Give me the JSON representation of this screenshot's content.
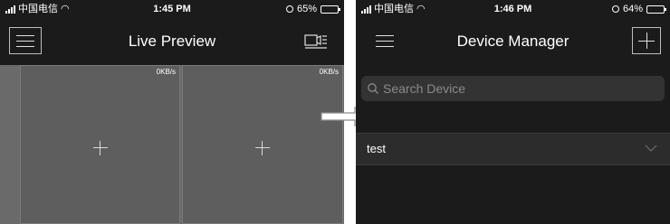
{
  "left_phone": {
    "status": {
      "carrier": "中国电信",
      "time": "1:45 PM",
      "battery": "65%",
      "battery_level": 0.65
    },
    "nav": {
      "title": "Live Preview",
      "menu_icon": "hamburger-menu-icon",
      "layout_icon": "layout-switch-icon"
    },
    "cells": [
      {
        "bitrate": "0KB/s",
        "icon": "plus-icon"
      },
      {
        "bitrate": "0KB/s",
        "icon": "plus-icon"
      }
    ]
  },
  "right_phone": {
    "status": {
      "carrier": "中国电信",
      "time": "1:46 PM",
      "battery": "64%",
      "battery_level": 0.64
    },
    "nav": {
      "title": "Device Manager",
      "menu_icon": "hamburger-menu-icon",
      "add_icon": "plus-icon"
    },
    "search": {
      "placeholder": "Search Device",
      "value": ""
    },
    "devices": [
      {
        "name": "test",
        "icon": "chevron-down-icon"
      }
    ]
  },
  "connector": {
    "icon": "outline-arrow-right-icon"
  },
  "colors": {
    "background": "#1b1b1b",
    "preview_grid": "#6a6a6a",
    "search_box": "#333333",
    "device_row": "#2c2c2c",
    "text": "#ffffff"
  }
}
